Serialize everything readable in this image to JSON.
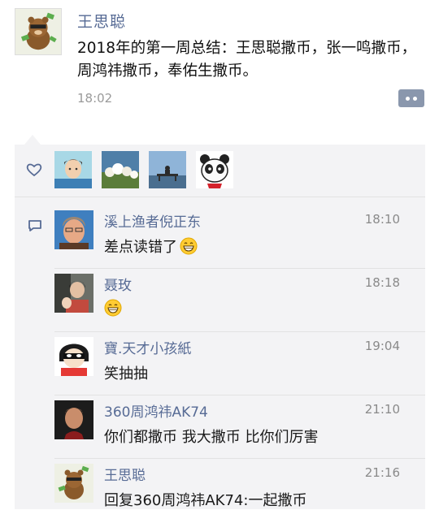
{
  "post": {
    "author": "王思聪",
    "content": "2018年的第一周总结：王思聪撒币，张一鸣撒币，周鸿祎撒币，奉佑生撒币。",
    "time": "18:02"
  },
  "likes": {
    "avatars": [
      "cartoon-boy-avatar",
      "flowers-photo-avatar",
      "bench-photo-avatar",
      "panda-avatar"
    ]
  },
  "comments": [
    {
      "name": "溪上渔者倪正东",
      "time": "18:10",
      "text": "差点读错了",
      "emoji": "grin-emoji"
    },
    {
      "name": "聂玫",
      "time": "18:18",
      "text": "",
      "emoji": "grin-emoji"
    },
    {
      "name": "寶.天才小孩紙",
      "time": "19:04",
      "text": "笑抽抽",
      "emoji": ""
    },
    {
      "name": "360周鸿祎AK74",
      "time": "21:10",
      "text": "你们都撒币 我大撒币 比你们厉害",
      "emoji": ""
    },
    {
      "name": "王思聪",
      "time": "21:16",
      "text": "回复360周鸿祎AK74:一起撒币",
      "emoji": ""
    }
  ],
  "colors": {
    "name_blue": "#576b95",
    "panel_bg": "#f3f3f5",
    "more_button": "#8a97ad"
  }
}
